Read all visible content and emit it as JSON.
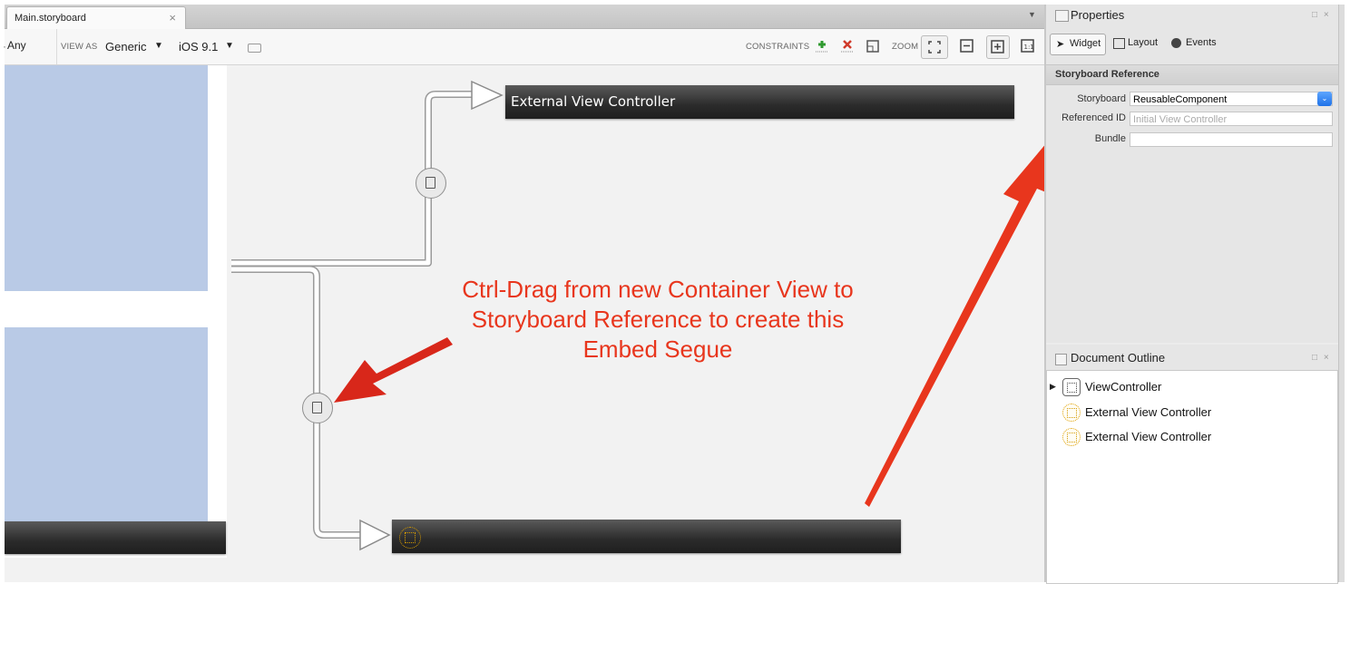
{
  "tab": {
    "title": "Main.storyboard",
    "close": "×",
    "menu": "▼"
  },
  "toolbar": {
    "size_class": "Any",
    "view_as_label": "VIEW AS",
    "device": "Generic",
    "device_arrow": "▼",
    "os": "iOS 9.1",
    "os_arrow": "▼",
    "constraints_label": "CONSTRAINTS",
    "zoom_label": "ZOOM"
  },
  "canvas": {
    "top_controller_title": "External View Controller",
    "annotation": [
      "Ctrl-Drag from new Container View to",
      "Storyboard Reference to create this",
      "Embed Segue"
    ],
    "annotation_color": "#e8361d"
  },
  "properties": {
    "title": "Properties",
    "window_buttons": "□ ×",
    "tabs": [
      {
        "label": "Widget",
        "icon": "cursor-icon",
        "active": true
      },
      {
        "label": "Layout",
        "icon": "layout-icon",
        "active": false
      },
      {
        "label": "Events",
        "icon": "events-icon",
        "active": false
      }
    ],
    "section": "Storyboard Reference",
    "fields": {
      "storyboard": {
        "label": "Storyboard",
        "value": "ReusableComponent"
      },
      "referenced_id": {
        "label": "Referenced ID",
        "placeholder": "Initial View Controller"
      },
      "bundle": {
        "label": "Bundle",
        "value": ""
      }
    }
  },
  "outline": {
    "title": "Document Outline",
    "window_buttons": "□ ×",
    "items": [
      {
        "label": "ViewController",
        "expandable": true
      },
      {
        "label": "External View Controller",
        "expandable": false
      },
      {
        "label": "External View Controller",
        "expandable": false
      }
    ]
  },
  "colors": {
    "accent_blue": "#1f72e8",
    "container_blue": "#b9cae6",
    "canvas": "#f2f2f2"
  }
}
